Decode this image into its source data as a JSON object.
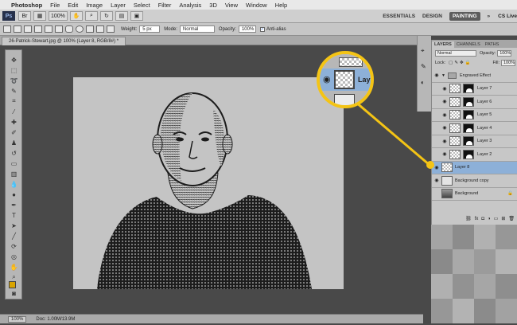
{
  "menubar": {
    "app_name": "Photoshop",
    "items": [
      "File",
      "Edit",
      "Image",
      "Layer",
      "Select",
      "Filter",
      "Analysis",
      "3D",
      "View",
      "Window",
      "Help"
    ]
  },
  "appbar": {
    "logo": "Ps",
    "zoom_value": "100%",
    "workspaces": [
      "ESSENTIALS",
      "DESIGN",
      "PAINTING"
    ],
    "active_workspace": "PAINTING",
    "more": "»",
    "cs_live": "CS Live"
  },
  "options": {
    "weight_label": "Weight:",
    "weight_value": "5 px",
    "mode_label": "Mode:",
    "mode_value": "Normal",
    "opacity_label": "Opacity:",
    "opacity_value": "100%",
    "antialias_label": "Anti-alias"
  },
  "document": {
    "tab_title": "26-Patrick-Stewart.jpg @ 100% (Layer 8, RGB/8#) *"
  },
  "statusbar": {
    "zoom": "100%",
    "doc_info": "Doc: 1.00M/13.9M"
  },
  "layers_panel": {
    "tabs": [
      "LAYERS",
      "CHANNELS",
      "PATHS"
    ],
    "blend_mode": "Normal",
    "opacity_label": "Opacity:",
    "opacity_value": "100%",
    "lock_label": "Lock:",
    "fill_label": "Fill:",
    "fill_value": "100%",
    "group_name": "Engraved Effect",
    "layers": [
      {
        "name": "Layer 7"
      },
      {
        "name": "Layer 6"
      },
      {
        "name": "Layer 5"
      },
      {
        "name": "Layer 4"
      },
      {
        "name": "Layer 3"
      },
      {
        "name": "Layer 2"
      },
      {
        "name": "Layer 8"
      },
      {
        "name": "Background copy"
      },
      {
        "name": "Background"
      }
    ],
    "selected_layer": "Layer 8"
  },
  "callout": {
    "label": "Lay",
    "color": "#f4c415"
  }
}
